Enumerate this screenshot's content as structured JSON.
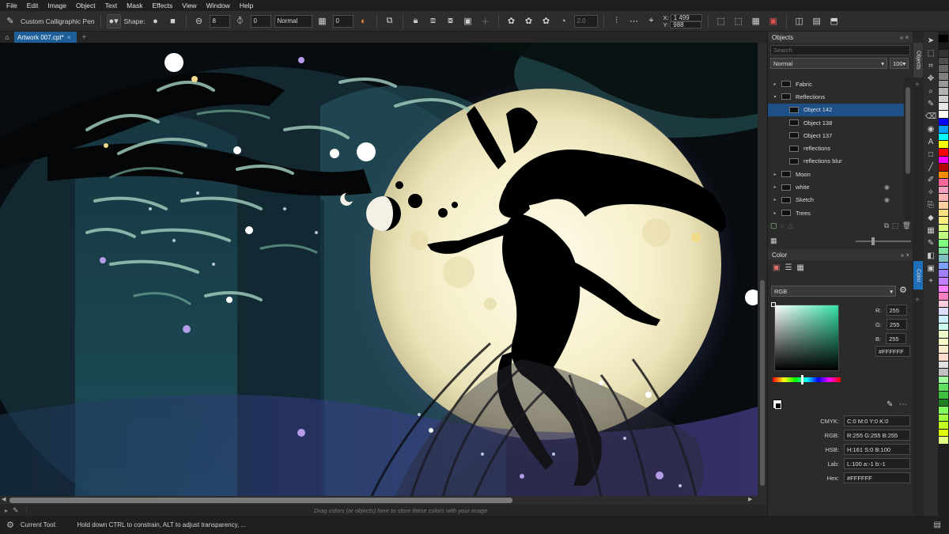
{
  "menu": [
    "File",
    "Edit",
    "Image",
    "Object",
    "Text",
    "Mask",
    "Effects",
    "View",
    "Window",
    "Help"
  ],
  "propbar": {
    "brush_name": "Custom Calligraphic Pen",
    "shape_label": "Shape:",
    "size_value": "8",
    "angle_value": "0",
    "merge_mode": "Normal",
    "transparency_value": "0",
    "smoothing_value": "2.0",
    "x_label": "X:",
    "x_value": "1 499",
    "y_label": "Y:",
    "y_value": "988"
  },
  "tab": {
    "doc_name": "Artwork 007.cpt*"
  },
  "objects": {
    "title": "Objects",
    "search_placeholder": "Search",
    "blend_mode": "Normal",
    "opacity": "100",
    "items": [
      {
        "label": "Fabric",
        "level": 0,
        "expand": "▸",
        "selected": false,
        "eye": ""
      },
      {
        "label": "Reflections",
        "level": 0,
        "expand": "▾",
        "selected": false,
        "eye": ""
      },
      {
        "label": "Object 142",
        "level": 1,
        "expand": "",
        "selected": true,
        "eye": ""
      },
      {
        "label": "Object 138",
        "level": 1,
        "expand": "",
        "selected": false,
        "eye": ""
      },
      {
        "label": "Object 137",
        "level": 1,
        "expand": "",
        "selected": false,
        "eye": ""
      },
      {
        "label": "reflections",
        "level": 1,
        "expand": "",
        "selected": false,
        "eye": ""
      },
      {
        "label": "reflections blur",
        "level": 1,
        "expand": "",
        "selected": false,
        "eye": ""
      },
      {
        "label": "Moon",
        "level": 0,
        "expand": "▸",
        "selected": false,
        "eye": ""
      },
      {
        "label": "white",
        "level": 0,
        "expand": "▸",
        "selected": false,
        "eye": "◉"
      },
      {
        "label": "Sketch",
        "level": 0,
        "expand": "▸",
        "selected": false,
        "eye": "◉"
      },
      {
        "label": "Trees",
        "level": 0,
        "expand": "▸",
        "selected": false,
        "eye": ""
      }
    ]
  },
  "color": {
    "title": "Color",
    "model": "RGB",
    "r_label": "R:",
    "r_value": "255",
    "g_label": "G:",
    "g_value": "255",
    "b_label": "B:",
    "b_value": "255",
    "hex_value": "#FFFFFF",
    "cmyk_label": "CMYK:",
    "cmyk_value": "C:0 M:0 Y:0 K:0",
    "rgb_label": "RGB:",
    "rgb_value": "R:255 G:255 B:255",
    "hsb_label": "HSB:",
    "hsb_value": "H:161 S:0 B:100",
    "lab_label": "Lab:",
    "lab_value": "L:100 a:-1 b:-1",
    "hex_label": "Hex:",
    "hex_value2": "#FFFFFF",
    "picker_hue": "#35e0a8"
  },
  "side_tabs": {
    "objects": "Objects",
    "color": "Color"
  },
  "color_tray_hint": "Drag colors (or objects) here to store these colors with your image",
  "status": {
    "label": "Current Tool:",
    "hint": "Hold down CTRL to constrain, ALT to adjust transparency, ..."
  },
  "palette": [
    "#000000",
    "#1a1a1a",
    "#333333",
    "#4d4d4d",
    "#666666",
    "#808080",
    "#999999",
    "#b3b3b3",
    "#cccccc",
    "#e6e6e6",
    "#ffffff",
    "#0000ff",
    "#00a0ff",
    "#00ffff",
    "#ffff00",
    "#ff0000",
    "#ff00ff",
    "#b30000",
    "#ff8c00",
    "#ff6699",
    "#f5a0c0",
    "#ffb3b3",
    "#ffd0a0",
    "#ffe080",
    "#fff080",
    "#e0ff80",
    "#c0ff80",
    "#80ff80",
    "#80e0a0",
    "#80c0c0",
    "#80a0ff",
    "#a080ff",
    "#c080ff",
    "#ff80ff",
    "#ff80c0",
    "#ffccdd",
    "#ddddff",
    "#cceeff",
    "#ccffee",
    "#eeffcc",
    "#ffffcc",
    "#ffeecc",
    "#ffddcc",
    "#e0e0e0",
    "#c0c0c0",
    "#a0ffa0",
    "#60e060",
    "#40c040",
    "#208020",
    "#80ff60",
    "#a0ff40",
    "#c0ff20",
    "#e0ff00",
    "#e0ff80"
  ],
  "accent": "#1f5f99"
}
